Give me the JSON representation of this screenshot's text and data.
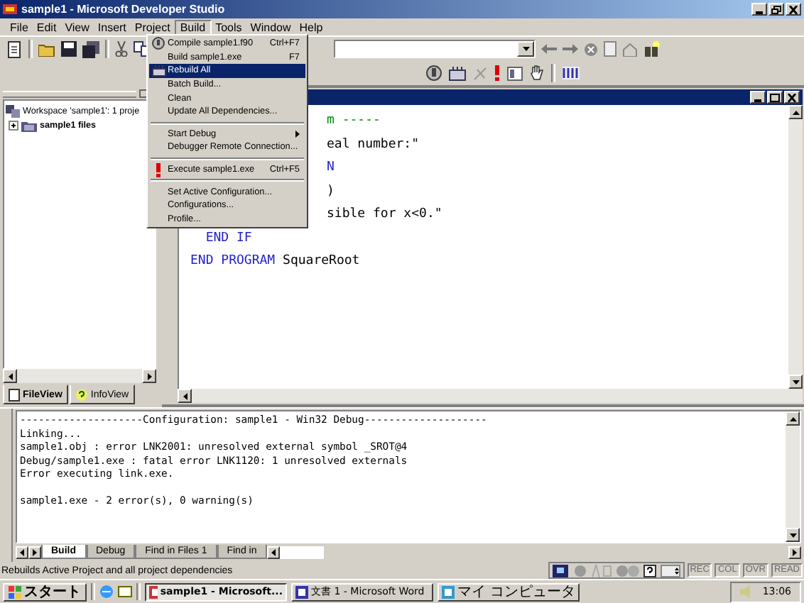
{
  "window": {
    "title": "sample1 - Microsoft Developer Studio"
  },
  "menu_bar": [
    {
      "label": "File",
      "selected": false
    },
    {
      "label": "Edit",
      "selected": false
    },
    {
      "label": "View",
      "selected": false
    },
    {
      "label": "Insert",
      "selected": false
    },
    {
      "label": "Project",
      "selected": false
    },
    {
      "label": "Build",
      "selected": true
    },
    {
      "label": "Tools",
      "selected": false
    },
    {
      "label": "Window",
      "selected": false
    },
    {
      "label": "Help",
      "selected": false
    }
  ],
  "build_menu": [
    {
      "kind": "item",
      "label": "Compile sample1.f90",
      "shortcut": "Ctrl+F7",
      "selected": false
    },
    {
      "kind": "item",
      "label": "Build sample1.exe",
      "shortcut": "F7",
      "selected": false
    },
    {
      "kind": "item",
      "label": "Rebuild All",
      "selected": true
    },
    {
      "kind": "item",
      "label": "Batch Build...",
      "selected": false
    },
    {
      "kind": "item",
      "label": "Clean",
      "selected": false
    },
    {
      "kind": "item",
      "label": "Update All Dependencies...",
      "selected": false
    },
    {
      "kind": "separator"
    },
    {
      "kind": "submenu",
      "label": "Start Debug",
      "selected": false
    },
    {
      "kind": "item",
      "label": "Debugger Remote Connection...",
      "selected": false
    },
    {
      "kind": "separator"
    },
    {
      "kind": "item",
      "label": "Execute sample1.exe",
      "shortcut": "Ctrl+F5",
      "selected": false
    },
    {
      "kind": "separator"
    },
    {
      "kind": "item",
      "label": "Set Active Configuration...",
      "selected": false
    },
    {
      "kind": "item",
      "label": "Configurations...",
      "selected": false
    },
    {
      "kind": "item",
      "label": "Profile...",
      "selected": false
    }
  ],
  "workspace": {
    "items": [
      {
        "label": "Workspace 'sample1': 1 proje",
        "children": [
          {
            "label": "sample1 files",
            "expanded": false
          }
        ]
      }
    ],
    "tabs": [
      {
        "label": "FileView",
        "selected": true
      },
      {
        "label": "InfoView",
        "selected": false
      }
    ]
  },
  "editor": {
    "lines": [
      {
        "kind": "clipped",
        "segments": [
          {
            "text": "m -----",
            "kind": "comment"
          }
        ]
      },
      {
        "kind": "clipped",
        "segments": [
          {
            "text": "eal number:\"",
            "kind": "plain"
          }
        ]
      },
      {
        "kind": "clipped",
        "segments": [
          {
            "text": "N",
            "kind": "keyword"
          }
        ]
      },
      {
        "kind": "clipped",
        "segments": [
          {
            "text": ")",
            "kind": "plain"
          }
        ]
      },
      {
        "kind": "clipped",
        "segments": [
          {
            "text": "sible for x<0.\"",
            "kind": "plain"
          }
        ]
      },
      {
        "kind": "full",
        "segments": [
          {
            "text": "  END IF",
            "kind": "keyword"
          }
        ]
      },
      {
        "kind": "full",
        "segments": [
          {
            "text": "END PROGRAM",
            "kind": "keyword"
          },
          {
            "text": " SquareRoot",
            "kind": "plain"
          }
        ]
      }
    ]
  },
  "output": {
    "lines": [
      {
        "kind": "log",
        "text": "--------------------Configuration: sample1 - Win32 Debug--------------------"
      },
      {
        "kind": "log",
        "text": "Linking..."
      },
      {
        "kind": "log",
        "text": "sample1.obj : error LNK2001: unresolved external symbol _SROT@4"
      },
      {
        "kind": "log",
        "text": "Debug/sample1.exe : fatal error LNK1120: 1 unresolved externals"
      },
      {
        "kind": "log",
        "text": "Error executing link.exe."
      },
      {
        "kind": "summary",
        "text": "sample1.exe - 2 error(s), 0 warning(s)"
      }
    ],
    "tabs": [
      {
        "label": "Build",
        "selected": true
      },
      {
        "label": "Debug",
        "selected": false
      },
      {
        "label": "Find in Files 1",
        "selected": false
      },
      {
        "label": "Find in",
        "selected": false
      }
    ]
  },
  "status_bar": {
    "message": "Rebuilds Active Project and all project dependencies",
    "indicators": [
      {
        "label": "REC",
        "disabled": true
      },
      {
        "label": "COL",
        "disabled": true
      },
      {
        "label": "OVR",
        "disabled": true
      },
      {
        "label": "READ",
        "disabled": true
      }
    ]
  },
  "taskbar": {
    "start": "スタート",
    "tasks": [
      {
        "label": "sample1 - Microsoft...",
        "selected": true
      },
      {
        "label": "文書 1 - Microsoft Word",
        "selected": false
      },
      {
        "label": "マイ コンピュータ",
        "selected": false
      }
    ],
    "clock": "13:06"
  }
}
